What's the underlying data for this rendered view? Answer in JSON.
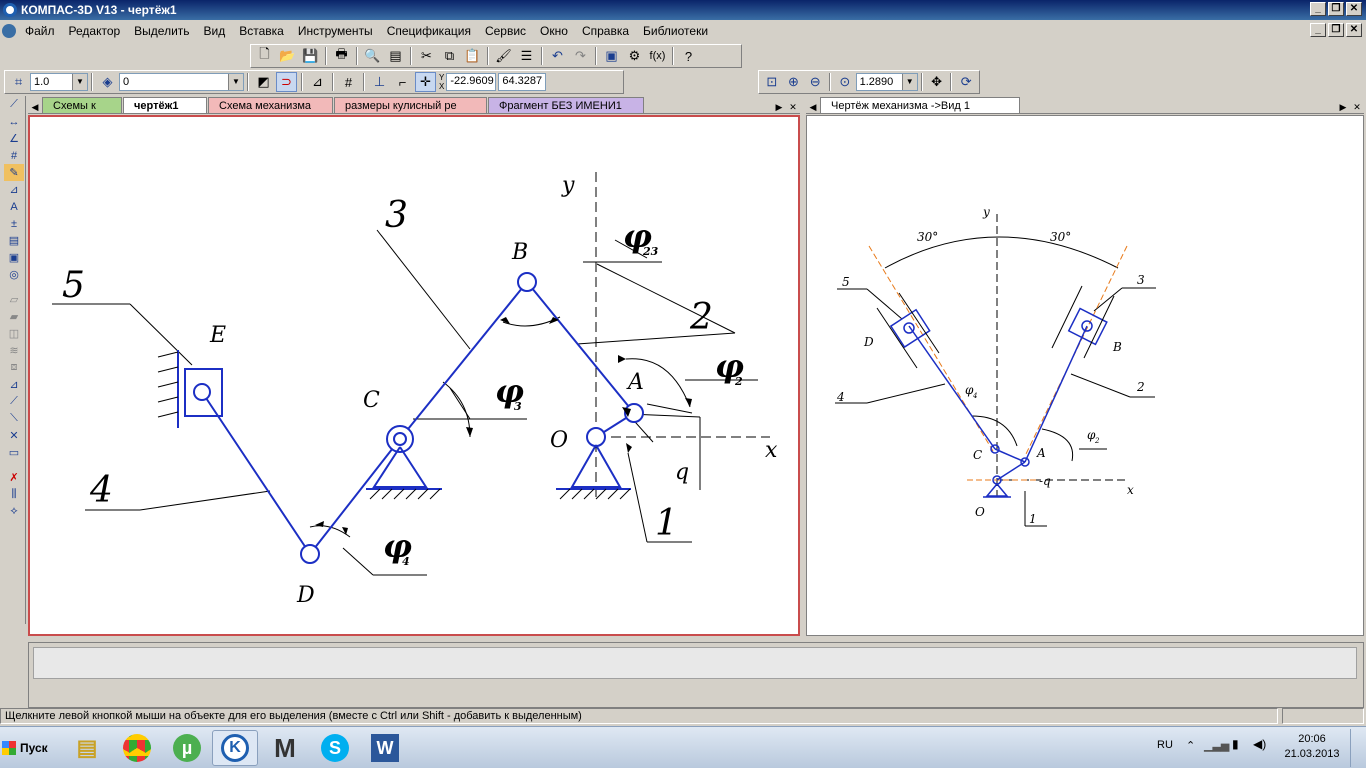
{
  "window": {
    "title": "КОМПАС-3D V13 - чертёж1",
    "min": "_",
    "restore": "❐",
    "close": "✕"
  },
  "menu": [
    "Файл",
    "Редактор",
    "Выделить",
    "Вид",
    "Вставка",
    "Инструменты",
    "Спецификация",
    "Сервис",
    "Окно",
    "Справка",
    "Библиотеки"
  ],
  "toolbar": {
    "scale_value": "1.0",
    "layer_value": "0",
    "coord_x": "-22.9609",
    "coord_y": "64.3287",
    "zoom_value": "1.2890",
    "axis_label_y": "Y",
    "axis_label_x": "X"
  },
  "tabs_left": [
    {
      "label": "Схемы к",
      "color": "#a7d48a"
    },
    {
      "label": "чертёж1",
      "color": "#f2b9b9",
      "active": true
    },
    {
      "label": "Схема механизма",
      "color": "#f2b9b9"
    },
    {
      "label": "размеры кулисный ре",
      "color": "#f2b9b9"
    },
    {
      "label": "Фрагмент БЕЗ ИМЕНИ1",
      "color": "#c8b3e6"
    }
  ],
  "tabs_right": [
    {
      "label": "Чертёж механизма ->Вид 1",
      "color": "#ffffff",
      "active": true
    }
  ],
  "left_drawing": {
    "labels": {
      "y": "y",
      "x": "x",
      "B": "B",
      "A": "A",
      "O": "O",
      "C": "C",
      "D": "D",
      "E": "E",
      "q": "q",
      "n1": "1",
      "n2": "2",
      "n3": "3",
      "n4": "4",
      "n5": "5",
      "phi23": "φ",
      "phi23_sub": "23",
      "phi2": "φ",
      "phi2_sub": "2",
      "phi3": "φ",
      "phi3_sub": "3",
      "phi4": "φ",
      "phi4_sub": "4"
    }
  },
  "right_drawing": {
    "labels": {
      "y": "y",
      "x": "x",
      "ang_left": "30°",
      "ang_right": "30°",
      "n1": "1",
      "n2": "2",
      "n3": "3",
      "n4": "4",
      "n5": "5",
      "B": "B",
      "D": "D",
      "C": "C",
      "A": "A",
      "O": "O",
      "q": "-q",
      "phi4": "φ",
      "phi4_sub": "4",
      "phi2": "φ",
      "phi2_sub": "2"
    }
  },
  "status": {
    "message": "Щелкните левой кнопкой мыши на объекте для его выделения (вместе с Ctrl или Shift - добавить к выделенным)"
  },
  "taskbar": {
    "start": "Пуск",
    "lang": "RU",
    "time": "20:06",
    "date": "21.03.2013"
  }
}
